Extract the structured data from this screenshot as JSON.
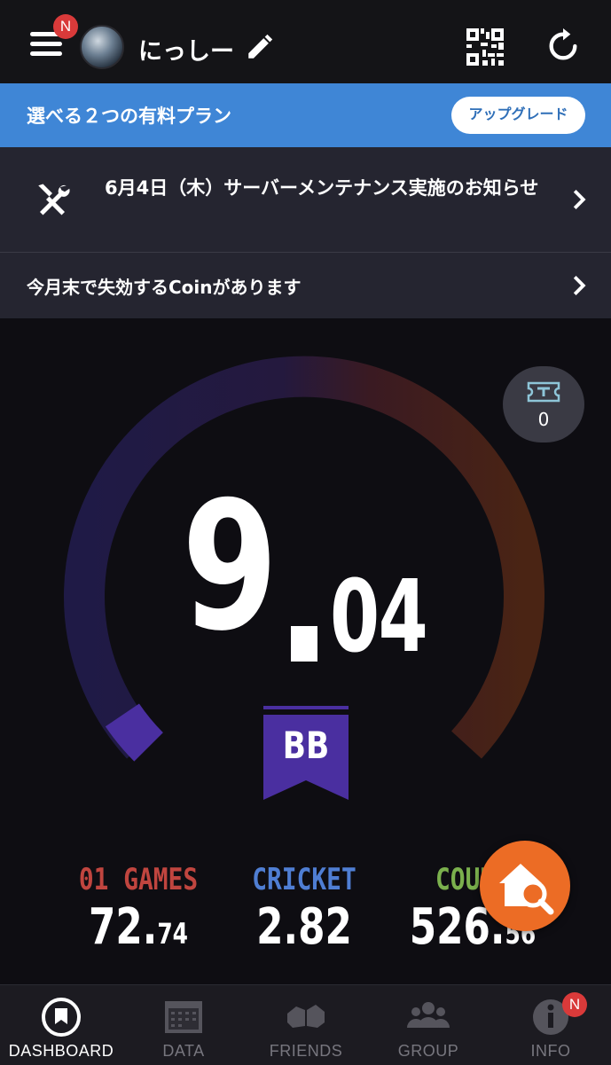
{
  "header": {
    "menu_badge": "N",
    "username": "にっしー"
  },
  "banner": {
    "text": "選べる２つの有料プラン",
    "upgrade_label": "アップグレード"
  },
  "notices": [
    {
      "text": "6月4日（木）サーバーメンテナンス実施のお知らせ"
    },
    {
      "text": "今月末で失効するCoinがあります"
    }
  ],
  "rating": {
    "integer": "9",
    "decimal": "04",
    "rank": "BB",
    "progress_fraction": 0.04
  },
  "tickets": {
    "count": "0"
  },
  "stats": [
    {
      "label": "01 GAMES",
      "int": "72.",
      "frac": "74",
      "color": "#c0453f"
    },
    {
      "label": "CRICKET",
      "int": "2.82",
      "frac": "",
      "color": "#4f7ed3"
    },
    {
      "label": "COUNT",
      "int": "526.",
      "frac": "56",
      "color": "#7bb04d"
    }
  ],
  "tabs": [
    {
      "label": "DASHBOARD",
      "icon": "dashboard-icon",
      "active": true
    },
    {
      "label": "DATA",
      "icon": "calendar-icon",
      "active": false
    },
    {
      "label": "FRIENDS",
      "icon": "friends-icon",
      "active": false
    },
    {
      "label": "GROUP",
      "icon": "group-icon",
      "active": false
    },
    {
      "label": "INFO",
      "icon": "info-icon",
      "active": false,
      "badge": "N"
    }
  ],
  "colors": {
    "banner": "#3f86d6",
    "accent_purple": "#4a2fa0",
    "fab": "#ec6c25",
    "badge": "#d93a3a"
  }
}
